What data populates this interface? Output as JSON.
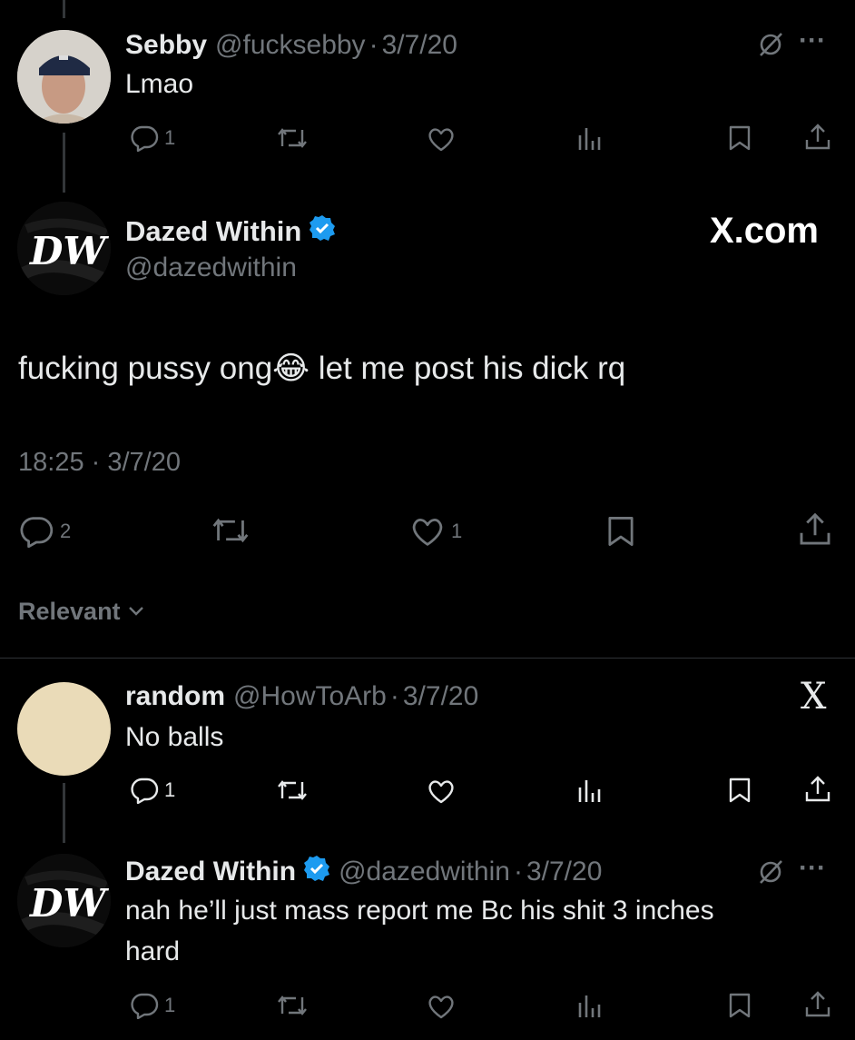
{
  "reply_top": {
    "name": "Sebby",
    "handle": "@fucksebby",
    "sep": "·",
    "date": "3/7/20",
    "text": "Lmao",
    "reply_count": "1",
    "more_label": "···"
  },
  "main_tweet": {
    "name": "Dazed Within",
    "handle": "@dazedwithin",
    "site_label": "X.com",
    "text_before": "fucking pussy ong",
    "emoji": "😂",
    "text_after": " let me post his dick rq",
    "timestamp": "18:25 · 3/7/20",
    "reply_count": "2",
    "like_count": "1",
    "avatar_text": "DW"
  },
  "sort_label": "Relevant",
  "reply_random": {
    "name": "random",
    "handle": "@HowToArb",
    "sep": "·",
    "date": "3/7/20",
    "text": "No balls",
    "reply_count": "1",
    "close_label": "X"
  },
  "reply_dazed": {
    "name": "Dazed Within",
    "handle": "@dazedwithin",
    "sep": "·",
    "date": "3/7/20",
    "text_line1": "nah he’ll just mass report me Bc his shit 3 inches",
    "text_line2": "hard",
    "reply_count": "1",
    "more_label": "···",
    "avatar_text": "DW"
  },
  "colors": {
    "background": "#000000",
    "text": "#e7e9ea",
    "muted": "#71767b",
    "verified": "#1d9bf0",
    "divider": "#2f3336"
  }
}
